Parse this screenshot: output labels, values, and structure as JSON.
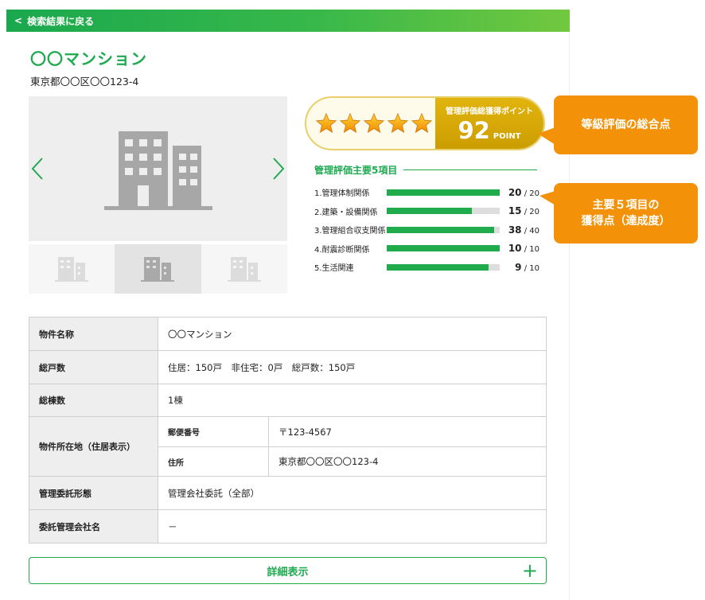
{
  "topbar": {
    "back_label": "検索結果に戻る"
  },
  "property": {
    "title": "〇〇マンション",
    "address": "東京都〇〇区〇〇123-4"
  },
  "gallery": {
    "thumbnail_count": 3,
    "active_thumbnail": 2
  },
  "score": {
    "stars": 5,
    "label": "管理評価総獲得ポイント",
    "value": "92",
    "unit": "POINT"
  },
  "items_header": "管理評価主要5項目",
  "items": [
    {
      "name": "1.管理体制関係",
      "score": "20",
      "max": "/ 20",
      "ratio": 1.0
    },
    {
      "name": "2.建築・設備関係",
      "score": "15",
      "max": "/ 20",
      "ratio": 0.75
    },
    {
      "name": "3.管理組合収支関係",
      "score": "38",
      "max": "/ 40",
      "ratio": 0.95
    },
    {
      "name": "4.耐震診断関係",
      "score": "10",
      "max": "/ 10",
      "ratio": 1.0
    },
    {
      "name": "5.生活関連",
      "score": "9",
      "max": "/ 10",
      "ratio": 0.9
    }
  ],
  "callouts": {
    "total": "等級評価の総合点",
    "items_line1": "主要５項目の",
    "items_line2": "獲得点（達成度）"
  },
  "table": {
    "name_label": "物件名称",
    "name_value": "〇〇マンション",
    "units_label": "総戸数",
    "units_value": "住居：150戸　非住宅：0戸　総戸数：150戸",
    "buildings_label": "総棟数",
    "buildings_value": "1棟",
    "location_label": "物件所在地（住居表示）",
    "postal_label": "郵便番号",
    "postal_value": "〒123-4567",
    "address_label": "住所",
    "address_value": "東京都〇〇区〇〇123-4",
    "mgmt_type_label": "管理委託形態",
    "mgmt_type_value": "管理会社委託（全部）",
    "mgmt_company_label": "委託管理会社名",
    "mgmt_company_value": "－"
  },
  "detail_button": {
    "label": "詳細表示",
    "plus": "+"
  },
  "colors": {
    "brand_green": "#1faa50",
    "gold": "#d6a806",
    "callout_orange": "#f39208"
  }
}
